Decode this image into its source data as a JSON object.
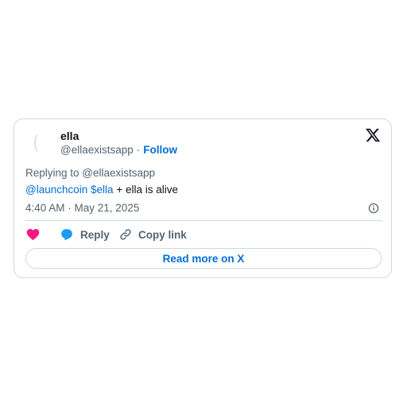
{
  "author": {
    "name": "ella",
    "handle": "@ellaexistsapp",
    "separator": "·",
    "follow_label": "Follow"
  },
  "reply_context": "Replying to @ellaexistsapp",
  "tweet": {
    "mention": "@launchcoin",
    "cashtag": "$ella",
    "text": "+ ella is alive"
  },
  "timestamp": "4:40 AM · May 21, 2025",
  "actions": {
    "like_count": "",
    "reply_label": "Reply",
    "copy_label": "Copy link"
  },
  "read_more_label": "Read more on X",
  "colors": {
    "link": "#006fd6",
    "like": "#f91880",
    "reply_icon": "#1d9bf0",
    "border": "#cfd9de",
    "muted_text": "#536471"
  },
  "icons": [
    "avatar-icon",
    "x-logo-icon",
    "info-icon",
    "heart-icon",
    "reply-bubble-icon",
    "link-icon"
  ]
}
